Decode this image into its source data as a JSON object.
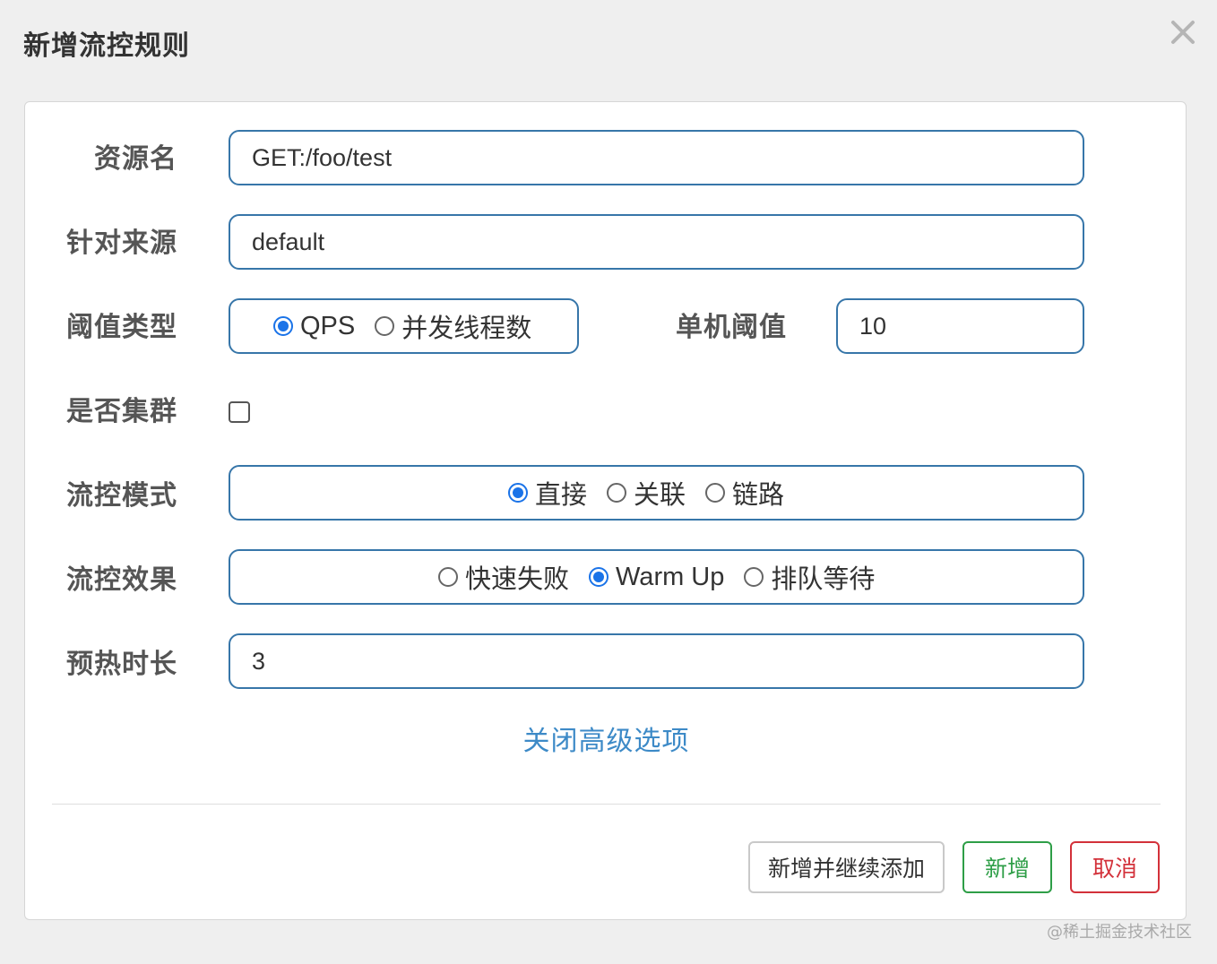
{
  "dialog": {
    "title": "新增流控规则"
  },
  "form": {
    "resource_name": {
      "label": "资源名",
      "value": "GET:/foo/test"
    },
    "limit_app": {
      "label": "针对来源",
      "value": "default"
    },
    "threshold_type": {
      "label": "阈值类型",
      "options": [
        "QPS",
        "并发线程数"
      ],
      "selected": "QPS"
    },
    "single_threshold": {
      "label": "单机阈值",
      "value": "10"
    },
    "cluster_mode": {
      "label": "是否集群",
      "checked": false
    },
    "control_mode": {
      "label": "流控模式",
      "options": [
        "直接",
        "关联",
        "链路"
      ],
      "selected": "直接"
    },
    "control_effect": {
      "label": "流控效果",
      "options": [
        "快速失败",
        "Warm Up",
        "排队等待"
      ],
      "selected": "Warm Up"
    },
    "warmup_period": {
      "label": "预热时长",
      "value": "3"
    },
    "advanced_toggle": "关闭高级选项"
  },
  "buttons": {
    "add_and_continue": "新增并继续添加",
    "add": "新增",
    "cancel": "取消"
  },
  "colors": {
    "input_border": "#3776a9",
    "radio_selected": "#1a73e8",
    "link": "#3d8ac7",
    "success": "#2e9e47",
    "danger": "#d3313a"
  },
  "watermark": "@稀土掘金技术社区"
}
